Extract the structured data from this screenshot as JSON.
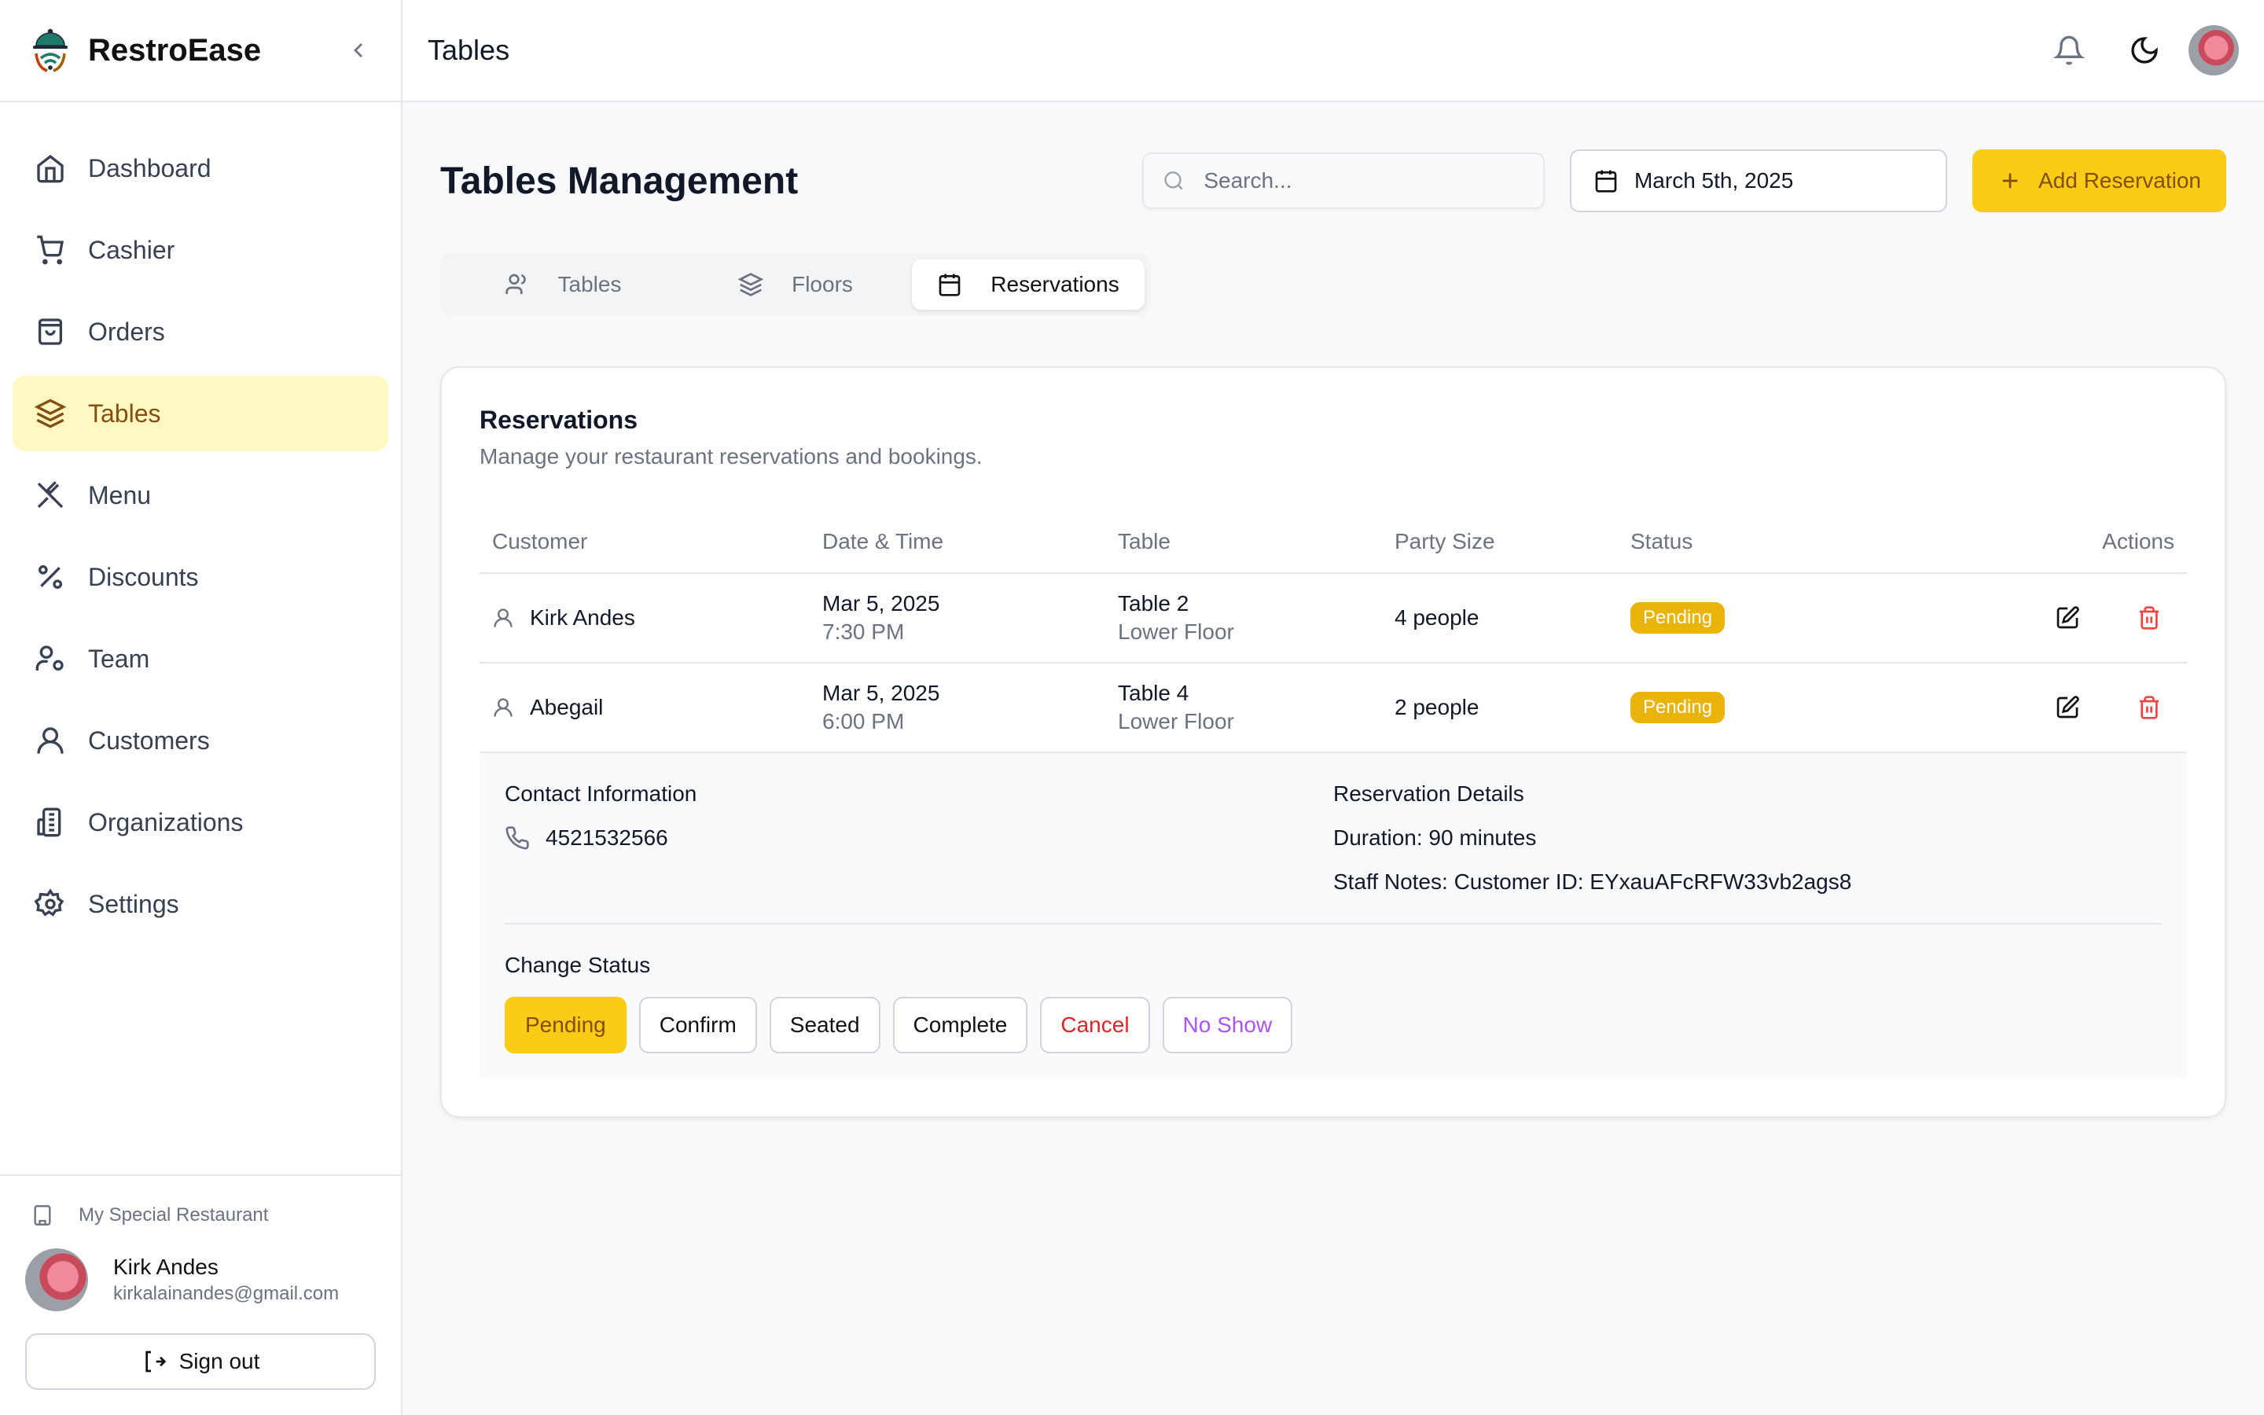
{
  "app": {
    "name": "RestroEase"
  },
  "sidebar": {
    "items": [
      {
        "label": "Dashboard",
        "icon": "home-icon",
        "active": false
      },
      {
        "label": "Cashier",
        "icon": "cart-icon",
        "active": false
      },
      {
        "label": "Orders",
        "icon": "shopping-bag-icon",
        "active": false
      },
      {
        "label": "Tables",
        "icon": "layers-icon",
        "active": true
      },
      {
        "label": "Menu",
        "icon": "utensils-crossed-icon",
        "active": false
      },
      {
        "label": "Discounts",
        "icon": "percent-icon",
        "active": false
      },
      {
        "label": "Team",
        "icon": "user-cog-icon",
        "active": false
      },
      {
        "label": "Customers",
        "icon": "user-icon",
        "active": false
      },
      {
        "label": "Organizations",
        "icon": "building-icon",
        "active": false
      },
      {
        "label": "Settings",
        "icon": "gear-icon",
        "active": false
      }
    ],
    "restaurant": "My Special Restaurant",
    "user": {
      "name": "Kirk Andes",
      "email": "kirkalainandes@gmail.com"
    },
    "signout_label": "Sign out"
  },
  "topbar": {
    "title": "Tables"
  },
  "page": {
    "title": "Tables Management",
    "search_placeholder": "Search...",
    "date": "March 5th, 2025",
    "add_label": "Add Reservation",
    "tabs": [
      {
        "label": "Tables",
        "active": false
      },
      {
        "label": "Floors",
        "active": false
      },
      {
        "label": "Reservations",
        "active": true
      }
    ]
  },
  "reservations": {
    "title": "Reservations",
    "description": "Manage your restaurant reservations and bookings.",
    "columns": [
      "Customer",
      "Date & Time",
      "Table",
      "Party Size",
      "Status",
      "Actions"
    ],
    "rows": [
      {
        "customer": "Kirk Andes",
        "date": "Mar 5, 2025",
        "time": "7:30 PM",
        "table": "Table 2",
        "floor": "Lower Floor",
        "party": "4 people",
        "status": "Pending"
      },
      {
        "customer": "Abegail",
        "date": "Mar 5, 2025",
        "time": "6:00 PM",
        "table": "Table 4",
        "floor": "Lower Floor",
        "party": "2 people",
        "status": "Pending"
      }
    ],
    "details": {
      "contact_label": "Contact Information",
      "phone": "4521532566",
      "reservation_label": "Reservation Details",
      "duration": "Duration: 90 minutes",
      "notes": "Staff Notes: Customer ID: EYxauAFcRFW33vb2ags8",
      "change_status_label": "Change Status",
      "status_buttons": [
        "Pending",
        "Confirm",
        "Seated",
        "Complete",
        "Cancel",
        "No Show"
      ]
    }
  },
  "colors": {
    "accent": "#facc15",
    "accent_text": "#854d0e",
    "active_bg": "#fef9c3",
    "badge": "#eab308",
    "danger": "#dc2626",
    "purple": "#a855f7"
  }
}
